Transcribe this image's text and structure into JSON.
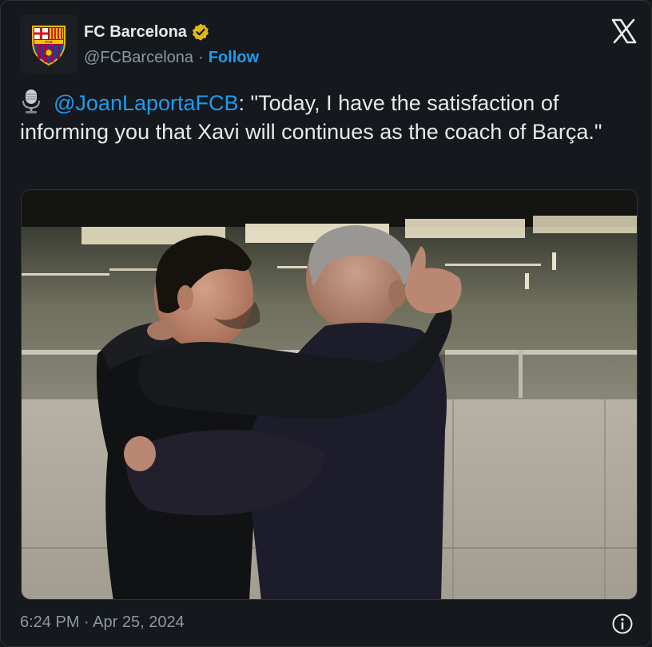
{
  "account": {
    "name": "FC Barcelona",
    "handle": "@FCBarcelona",
    "separator": "·",
    "follow_label": "Follow"
  },
  "tweet": {
    "mention": "@JoanLaportaFCB",
    "text": ": \"Today, I have the satisfaction of informing you that Xavi will continues as the coach of Barça.\""
  },
  "footer": {
    "timestamp": "6:24 PM · Apr 25, 2024"
  },
  "icons": {
    "avatar": "fc-barcelona-crest-icon",
    "verified": "gold-verified-badge-icon",
    "platform": "x-logo-icon",
    "microphone": "studio-microphone-icon",
    "info": "info-icon"
  },
  "colors": {
    "background": "#15181c",
    "text": "#e7e9ea",
    "muted": "#8b98a5",
    "link": "#1d9bf0",
    "verified_gold": "#e2b719"
  }
}
